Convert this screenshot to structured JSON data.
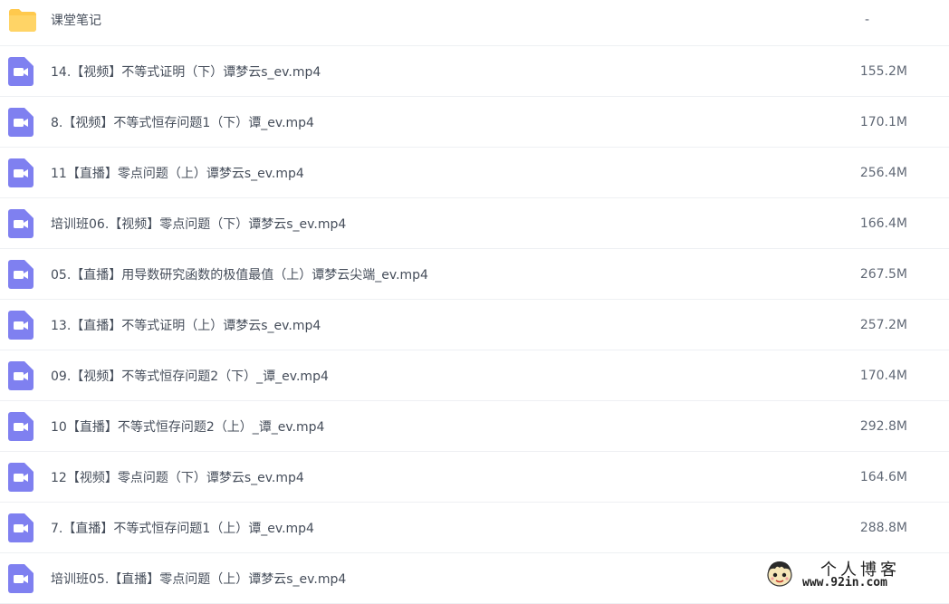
{
  "files": [
    {
      "name": "课堂笔记",
      "size": "-",
      "type": "folder"
    },
    {
      "name": "14.【视频】不等式证明（下）谭梦云s_ev.mp4",
      "size": "155.2M",
      "type": "video"
    },
    {
      "name": "8.【视频】不等式恒存问题1（下）谭_ev.mp4",
      "size": "170.1M",
      "type": "video"
    },
    {
      "name": "11【直播】零点问题（上）谭梦云s_ev.mp4",
      "size": "256.4M",
      "type": "video"
    },
    {
      "name": "培训班06.【视频】零点问题（下）谭梦云s_ev.mp4",
      "size": "166.4M",
      "type": "video"
    },
    {
      "name": "05.【直播】用导数研究函数的极值最值（上）谭梦云尖端_ev.mp4",
      "size": "267.5M",
      "type": "video"
    },
    {
      "name": "13.【直播】不等式证明（上）谭梦云s_ev.mp4",
      "size": "257.2M",
      "type": "video"
    },
    {
      "name": "09.【视频】不等式恒存问题2（下）_谭_ev.mp4",
      "size": "170.4M",
      "type": "video"
    },
    {
      "name": "10【直播】不等式恒存问题2（上）_谭_ev.mp4",
      "size": "292.8M",
      "type": "video"
    },
    {
      "name": "12【视频】零点问题（下）谭梦云s_ev.mp4",
      "size": "164.6M",
      "type": "video"
    },
    {
      "name": "7.【直播】不等式恒存问题1（上）谭_ev.mp4",
      "size": "288.8M",
      "type": "video"
    },
    {
      "name": "培训班05.【直播】零点问题（上）谭梦云s_ev.mp4",
      "size": "",
      "type": "video"
    }
  ],
  "icons": {
    "folder": "folder-icon",
    "video": "video-file-icon"
  },
  "colors": {
    "folder": "#ffc94d",
    "video": "#7f80f0",
    "divider": "#eef0f3"
  },
  "watermark": {
    "title": "个人博客",
    "url": "www.92in.com"
  }
}
